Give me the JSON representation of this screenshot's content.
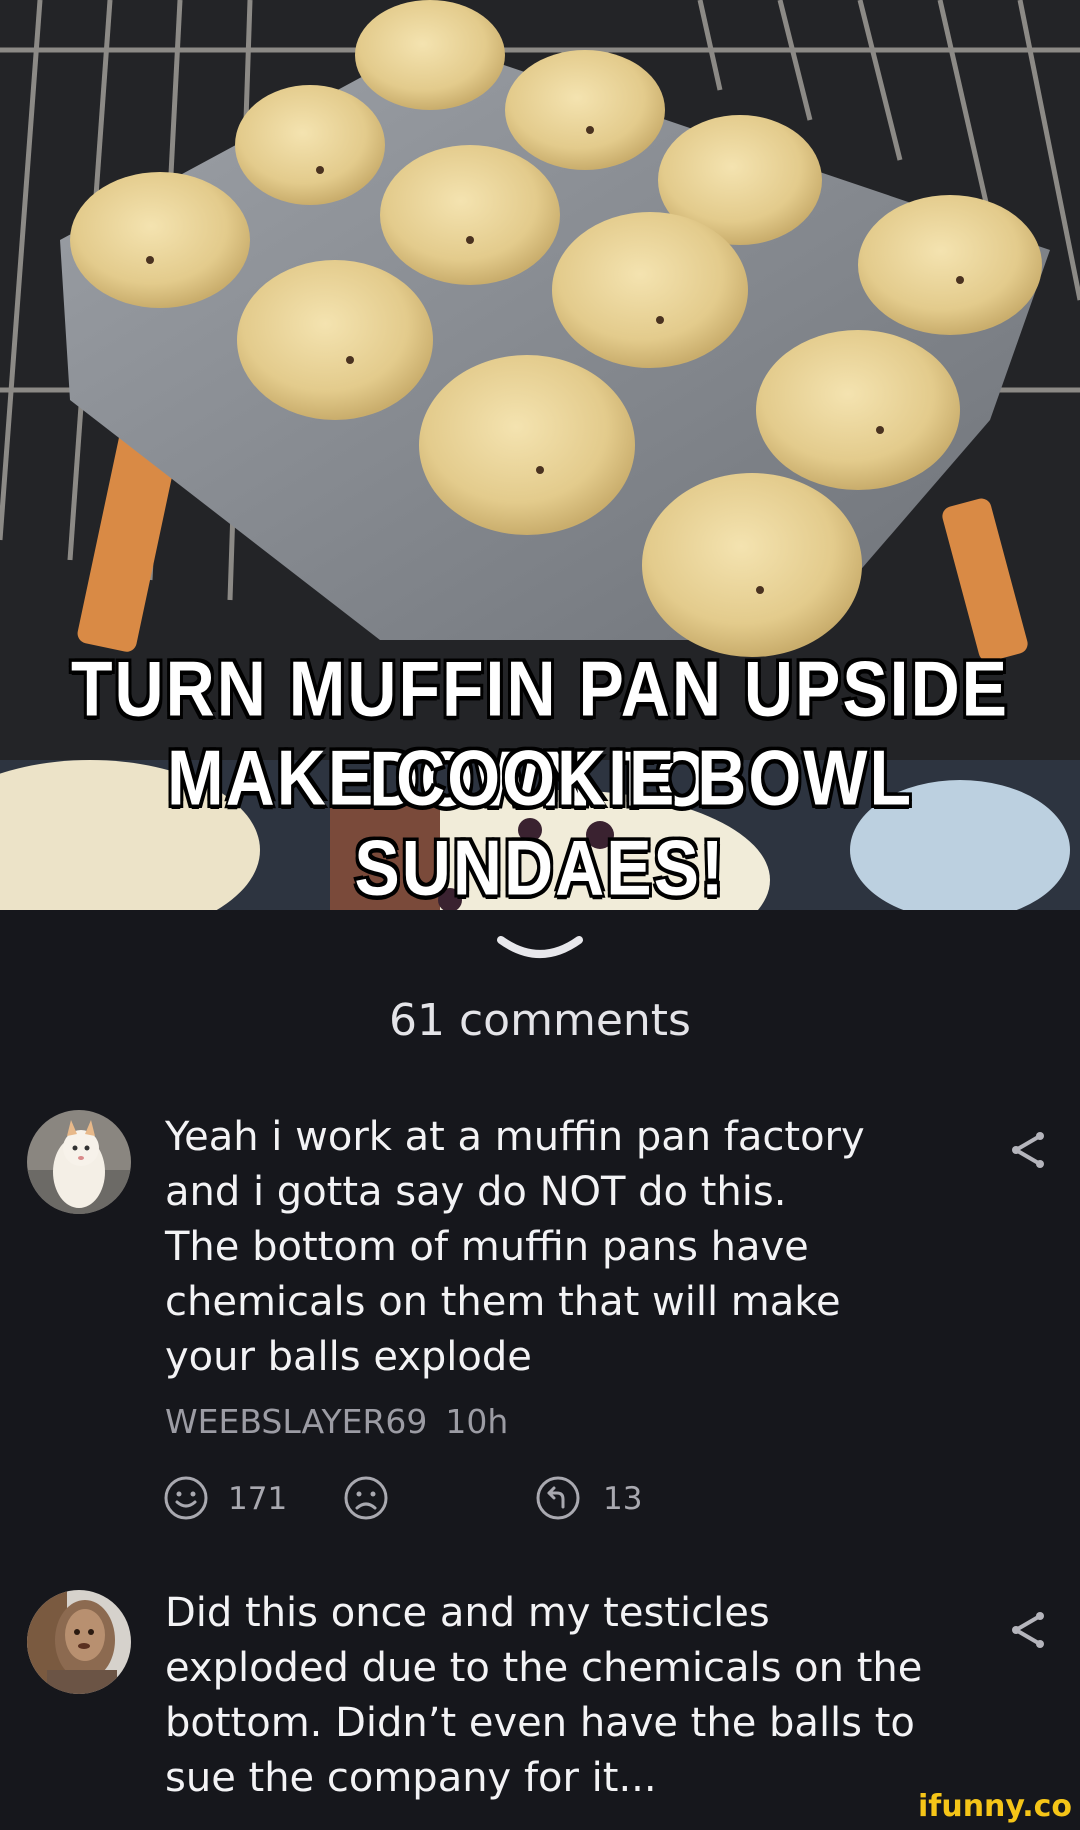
{
  "meme": {
    "caption_line1": "TURN MUFFIN PAN UPSIDE DOWN TO",
    "caption_line2": "MAKE COOKIE BOWL SUNDAES!"
  },
  "comments_section": {
    "count_label": "61 comments"
  },
  "comments": [
    {
      "text_lines": [
        "Yeah i work at a muffin pan factory",
        "and i gotta say do NOT do this.",
        "The bottom of muffin pans have",
        "chemicals on them that will make",
        "your balls explode"
      ],
      "author": "WEEBSLAYER69",
      "time": "10h",
      "smile_count": "171",
      "reply_count": "13"
    },
    {
      "text_lines": [
        "Did this once and my testicles",
        "exploded due to the chemicals on the",
        "bottom. Didn’t even have the balls to",
        "sue the company for it..."
      ]
    }
  ],
  "watermark": "ifunny.co",
  "colors": {
    "background": "#16171c",
    "muted_text": "#9c9ca4",
    "watermark": "#f5c518"
  },
  "icons": [
    "chevron-down-icon",
    "share-icon",
    "smile-icon",
    "frown-icon",
    "reply-icon"
  ]
}
